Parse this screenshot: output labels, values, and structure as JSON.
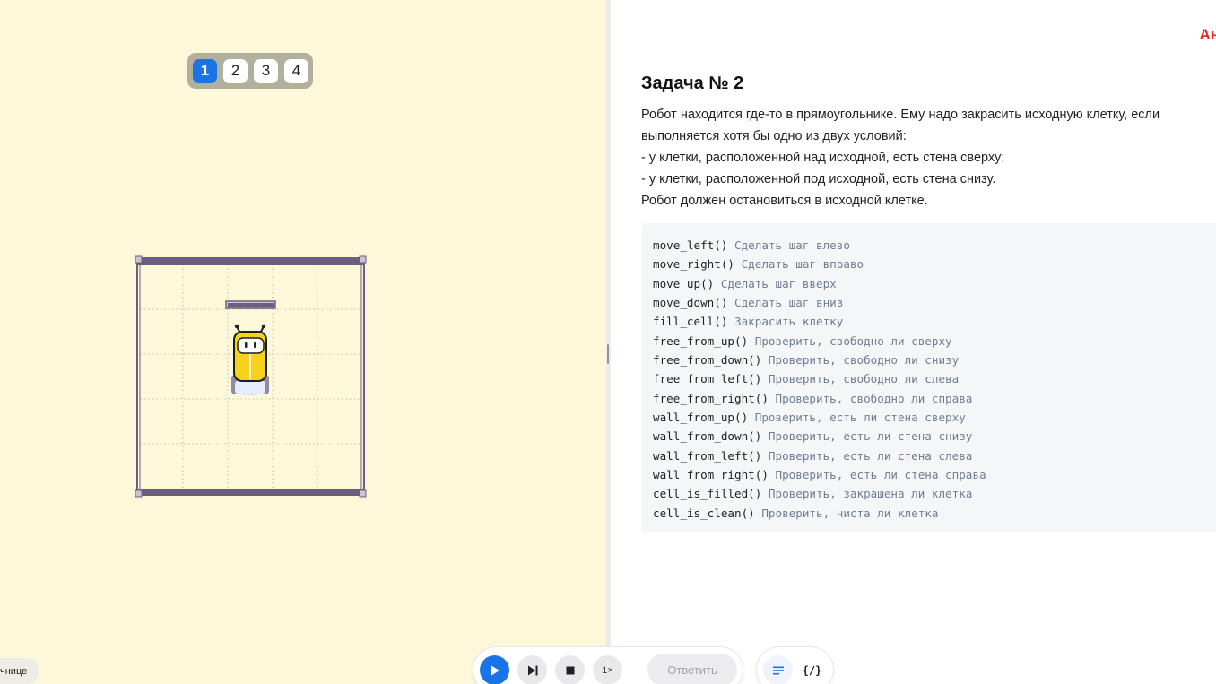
{
  "level_tabs": [
    {
      "label": "1",
      "active": true
    },
    {
      "label": "2",
      "active": false
    },
    {
      "label": "3",
      "active": false
    },
    {
      "label": "4",
      "active": false
    }
  ],
  "footer_hint": "чнице",
  "task": {
    "title": "Задача № 2",
    "description_lines": [
      "Робот находится где-то в прямоугольнике. Ему надо закрасить исходную клетку, если",
      "выполняется хотя бы одно из двух условий:",
      "- у клетки, расположенной над исходной, есть стена сверху;",
      "- у клетки, расположенной под исходной, есть стена снизу.",
      "Робот должен остановиться в исходной клетке."
    ]
  },
  "top_right_text": "Ан",
  "api": [
    {
      "fn": "move_left()",
      "desc": "Сделать шаг влево"
    },
    {
      "fn": "move_right()",
      "desc": "Сделать шаг вправо"
    },
    {
      "fn": "move_up()",
      "desc": "Сделать шаг вверх"
    },
    {
      "fn": "move_down()",
      "desc": "Сделать шаг вниз"
    },
    {
      "fn": "fill_cell()",
      "desc": "Закрасить клетку"
    },
    {
      "fn": "free_from_up()",
      "desc": "Проверить, свободно ли сверху"
    },
    {
      "fn": "free_from_down()",
      "desc": "Проверить, свободно ли снизу"
    },
    {
      "fn": "free_from_left()",
      "desc": "Проверить, свободно ли слева"
    },
    {
      "fn": "free_from_right()",
      "desc": "Проверить, свободно ли справа"
    },
    {
      "fn": "wall_from_up()",
      "desc": "Проверить, есть ли стена сверху"
    },
    {
      "fn": "wall_from_down()",
      "desc": "Проверить, есть ли стена снизу"
    },
    {
      "fn": "wall_from_left()",
      "desc": "Проверить, есть ли стена слева"
    },
    {
      "fn": "wall_from_right()",
      "desc": "Проверить, есть ли стена справа"
    },
    {
      "fn": "cell_is_filled()",
      "desc": "Проверить, закрашена ли клетка"
    },
    {
      "fn": "cell_is_clean()",
      "desc": "Проверить, чиста ли клетка"
    }
  ],
  "controls": {
    "speed_label": "1×",
    "answer_label": "Ответить"
  },
  "colors": {
    "field_bg": "#fdf8d9",
    "accent": "#1a74e8",
    "wall": "#6a5f7e",
    "robot_body": "#f7d21a"
  },
  "icons": [
    "play-icon",
    "step-icon",
    "stop-icon",
    "text-view-icon",
    "code-view-icon"
  ]
}
